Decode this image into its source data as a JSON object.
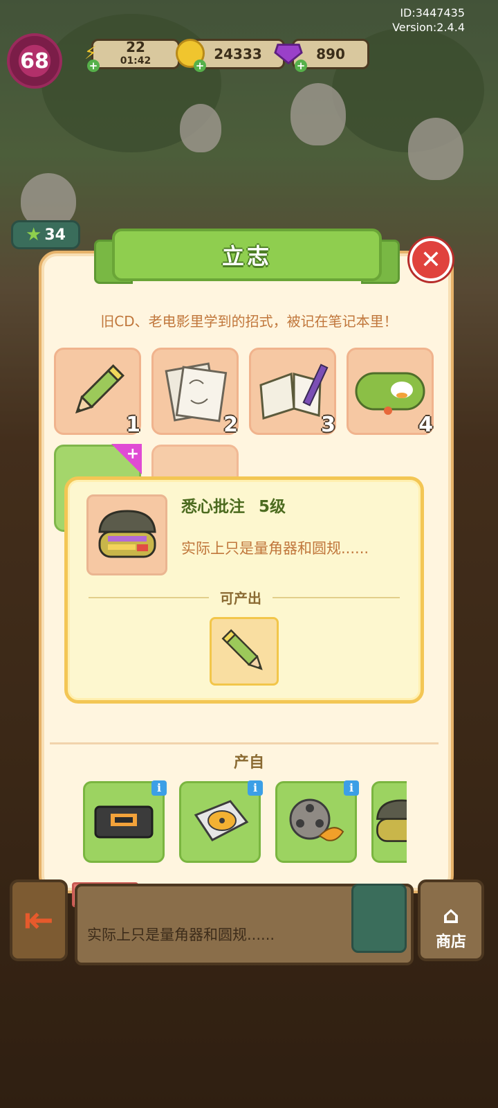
{
  "hud": {
    "player_level": "68",
    "energy": "22",
    "energy_timer": "01:42",
    "coins": "24333",
    "gems": "890",
    "id_text": "ID:3447435",
    "version_text": "Version:2.4.4",
    "star_count": "34"
  },
  "popup": {
    "title": "立志",
    "description": "旧CD、老电影里学到的招式，被记在笔记本里！",
    "chain_items": [
      {
        "level": "1",
        "icon": "pencil-icon"
      },
      {
        "level": "2",
        "icon": "sketch-paper-icon"
      },
      {
        "level": "3",
        "icon": "notebook-icon"
      },
      {
        "level": "4",
        "icon": "pencil-case-icon"
      }
    ],
    "detail": {
      "name": "悉心批注",
      "level": "5级",
      "subtitle": "实际上只是量角器和圆规......",
      "produces_label": "可产出",
      "produces_icon": "pencil-icon"
    },
    "from_label": "产自",
    "sources": [
      {
        "icon": "vhs-tape-icon"
      },
      {
        "icon": "cd-player-icon"
      },
      {
        "icon": "film-reel-icon"
      },
      {
        "icon": "open-pencil-case-icon"
      }
    ]
  },
  "bottom_bar": {
    "description": "实际上只是量角器和圆规......",
    "shop_label": "商店"
  },
  "colors": {
    "accent_green": "#8fce4f",
    "close_red": "#e0423d",
    "panel_bg": "#fff5df",
    "desc_text": "#c0763b"
  }
}
